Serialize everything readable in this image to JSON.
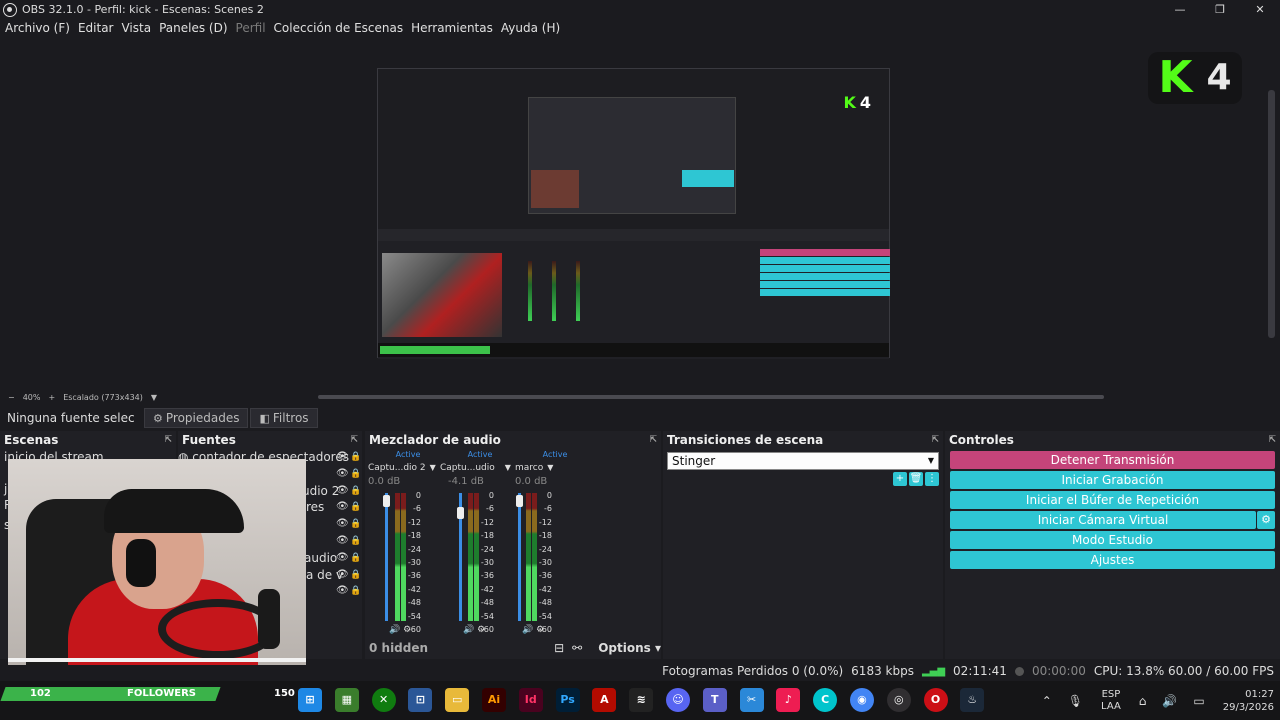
{
  "window": {
    "title": "OBS 32.1.0 - Perfil: kick - Escenas: Scenes 2",
    "controls": [
      "—",
      "❐",
      "✕"
    ]
  },
  "menu": [
    "Archivo (F)",
    "Editar",
    "Vista",
    "Paneles (D)",
    "Perfil",
    "Colección de Escenas",
    "Herramientas",
    "Ayuda (H)"
  ],
  "overlay": {
    "brand_letter": "K",
    "number": "4"
  },
  "zoom": {
    "percent": "40%",
    "scaling": "Escalado (773x434)"
  },
  "propbar": {
    "no_source": "Ninguna fuente selec",
    "properties": "Propiedades",
    "filters": "Filtros"
  },
  "docks": {
    "scenes": {
      "title": "Escenas",
      "items": [
        "inicio del stream",
        "j",
        "R",
        "s"
      ]
    },
    "sources": {
      "title": "Fuentes",
      "items": [
        "contador de espectadores",
        "",
        "udio 2",
        "res",
        "",
        "",
        "audio",
        "a de v",
        ""
      ]
    },
    "mixer": {
      "title": "Mezclador de audio",
      "channels": [
        {
          "status": "Active",
          "name": "Captu...dio 2",
          "db": "0.0 dB"
        },
        {
          "status": "Active",
          "name": "Captu...udio",
          "db": "-4.1 dB"
        },
        {
          "status": "Active",
          "name": "marco",
          "db": "0.0 dB"
        }
      ],
      "scale": [
        "0",
        "-6",
        "-12",
        "-18",
        "-24",
        "-30",
        "-36",
        "-42",
        "-48",
        "-54",
        "-60"
      ],
      "hidden_label": "0 hidden",
      "options_label": "Options"
    },
    "transitions": {
      "title": "Transiciones de escena",
      "selected": "Stinger"
    },
    "controls": {
      "title": "Controles",
      "buttons": [
        "Detener Transmisión",
        "Iniciar Grabación",
        "Iniciar el Búfer de Repetición",
        "Iniciar Cámara Virtual",
        "Modo Estudio",
        "Ajustes"
      ]
    }
  },
  "status": {
    "dropped": "Fotogramas Perdidos 0 (0.0%)",
    "kbps": "6183 kbps",
    "stream_time": "02:11:41",
    "rec_time": "00:00:00",
    "cpu": "CPU: 13.8% 60.00 / 60.00 FPS"
  },
  "followers": {
    "current": "102",
    "label": "FOLLOWERS",
    "goal": "150"
  },
  "taskbar": {
    "apps": [
      "windows-icon",
      "minecraft-icon",
      "xbox-icon",
      "store-icon",
      "explorer-icon",
      "illustrator-icon",
      "indesign-icon",
      "photoshop-icon",
      "acrobat-icon",
      "capcut-icon",
      "discord-icon",
      "teams-icon",
      "snipping-icon",
      "tiktok-icon",
      "canva-icon",
      "chrome-icon",
      "obs-icon",
      "opera-icon",
      "steam-icon"
    ],
    "lang_top": "ESP",
    "lang_bottom": "LAA",
    "time": "01:27",
    "date": "29/3/2026"
  },
  "colors": {
    "accent": "#2ec6d3",
    "stop": "#c4447a",
    "kick_green": "#53fc18",
    "followers_bar": "#3bb34a"
  }
}
